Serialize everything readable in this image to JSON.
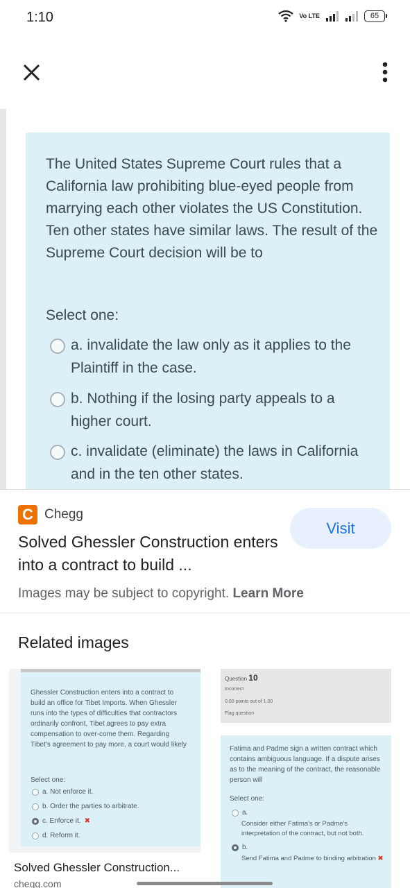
{
  "status_bar": {
    "time": "1:10",
    "network_label": "Vo LTE",
    "battery": "65"
  },
  "question_image": {
    "question": "The United States Supreme Court rules that a California law prohibiting blue-eyed people from marrying each other violates the US Constitution. Ten other states have similar laws. The result of the Supreme Court decision will be to",
    "select_label": "Select one:",
    "options": [
      "a. invalidate the law only as it applies to the Plaintiff in the case.",
      "b. Nothing if the losing party appeals to a higher court.",
      "c. invalidate (eliminate) the laws in California and in the ten other states."
    ]
  },
  "result": {
    "source_logo_letter": "C",
    "source_name": "Chegg",
    "visit_label": "Visit",
    "title": "Solved Ghessler Construction enters into a contract to build ...",
    "copyright_text": "Images may be subject to copyright.",
    "learn_more": "Learn More"
  },
  "related": {
    "heading": "Related images",
    "items": [
      {
        "question": "Ghessler Construction enters into a contract to build an office for Tibet Imports. When Ghessler runs into the types of difficulties that contractors ordinarily confront, Tibet agrees to pay extra compensation to over-come them. Regarding Tibet's agreement to pay more, a court would likely",
        "select_label": "Select one:",
        "options": [
          "a. Not enforce it.",
          "b. Order the parties to arbitrate.",
          "c. Enforce it.",
          "d. Reform it."
        ],
        "wrong_mark": "✖",
        "title": "Solved Ghessler Construction...",
        "source": "chegg.com"
      },
      {
        "question_label": "Question",
        "question_number": "10",
        "status": "Incorrect",
        "points": "0.00 points out of 1.00",
        "flag": "Flag question",
        "question": "Fatima and Padme sign a written contract which contains ambiguous language. If a dispute arises as to the meaning of the contract, the reasonable person will",
        "select_label": "Select one:",
        "options": [
          {
            "letter": "a.",
            "text": "Consider either Fatima's or Padme's interpretation of the contract, but not both."
          },
          {
            "letter": "b.",
            "text": "Send Fatima and Padme to binding arbitration"
          }
        ],
        "wrong_mark": "✖"
      }
    ]
  },
  "colors": {
    "card_bg": "#dcf0f7",
    "visit_bg": "#e8f0fe",
    "visit_text": "#1a73e8",
    "chegg_orange": "#eb7100",
    "wrong_red": "#d93025"
  }
}
